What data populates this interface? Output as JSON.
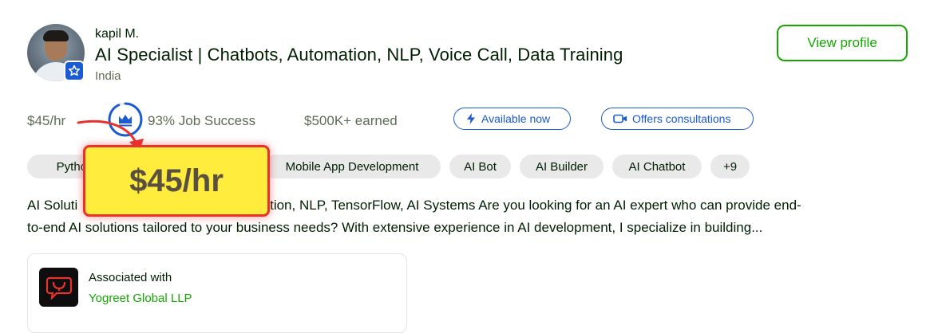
{
  "freelancer": {
    "name": "kapil M.",
    "title": "AI Specialist | Chatbots, Automation, NLP, Voice Call, Data Training",
    "country": "India"
  },
  "actions": {
    "view_profile": "View profile"
  },
  "stats": {
    "rate": "$45/hr",
    "job_success": "93% Job Success",
    "job_success_value": 0.93,
    "earned": "$500K+ earned"
  },
  "badges": {
    "available": "Available now",
    "consultations": "Offers consultations"
  },
  "skills": [
    "Python",
    "Mobile App Development",
    "AI Bot",
    "AI Builder",
    "AI Chatbot",
    "+9"
  ],
  "description": "AI Solutions, Chatbots, Automation, NLP, TensorFlow, AI Systems Are you looking for an AI expert who can provide end-to-end AI solutions tailored to your business needs? With extensive experience in AI development, I specialize in building...",
  "description_visible": {
    "line1_start": "AI Soluti",
    "line1_end": "tomation, NLP, TensorFlow, AI Systems Are you looking for an AI expert who can provide end-",
    "line2": "to-end AI solutions tailored to your business needs? With extensive experience in AI development, I specialize in building..."
  },
  "association": {
    "label": "Associated with",
    "company": "Yogreet Global LLP"
  },
  "callout": {
    "text": "$45/hr"
  },
  "colors": {
    "brand_green": "#14a800",
    "accent_blue": "#1a5ad3",
    "callout_fill": "#ffec3d",
    "callout_border": "#e8322d",
    "muted_text": "#5e6d55"
  },
  "icons": {
    "verified_badge": "star-badge-icon",
    "job_success": "crown-icon",
    "available": "lightning-icon",
    "consultations": "video-camera-icon"
  }
}
